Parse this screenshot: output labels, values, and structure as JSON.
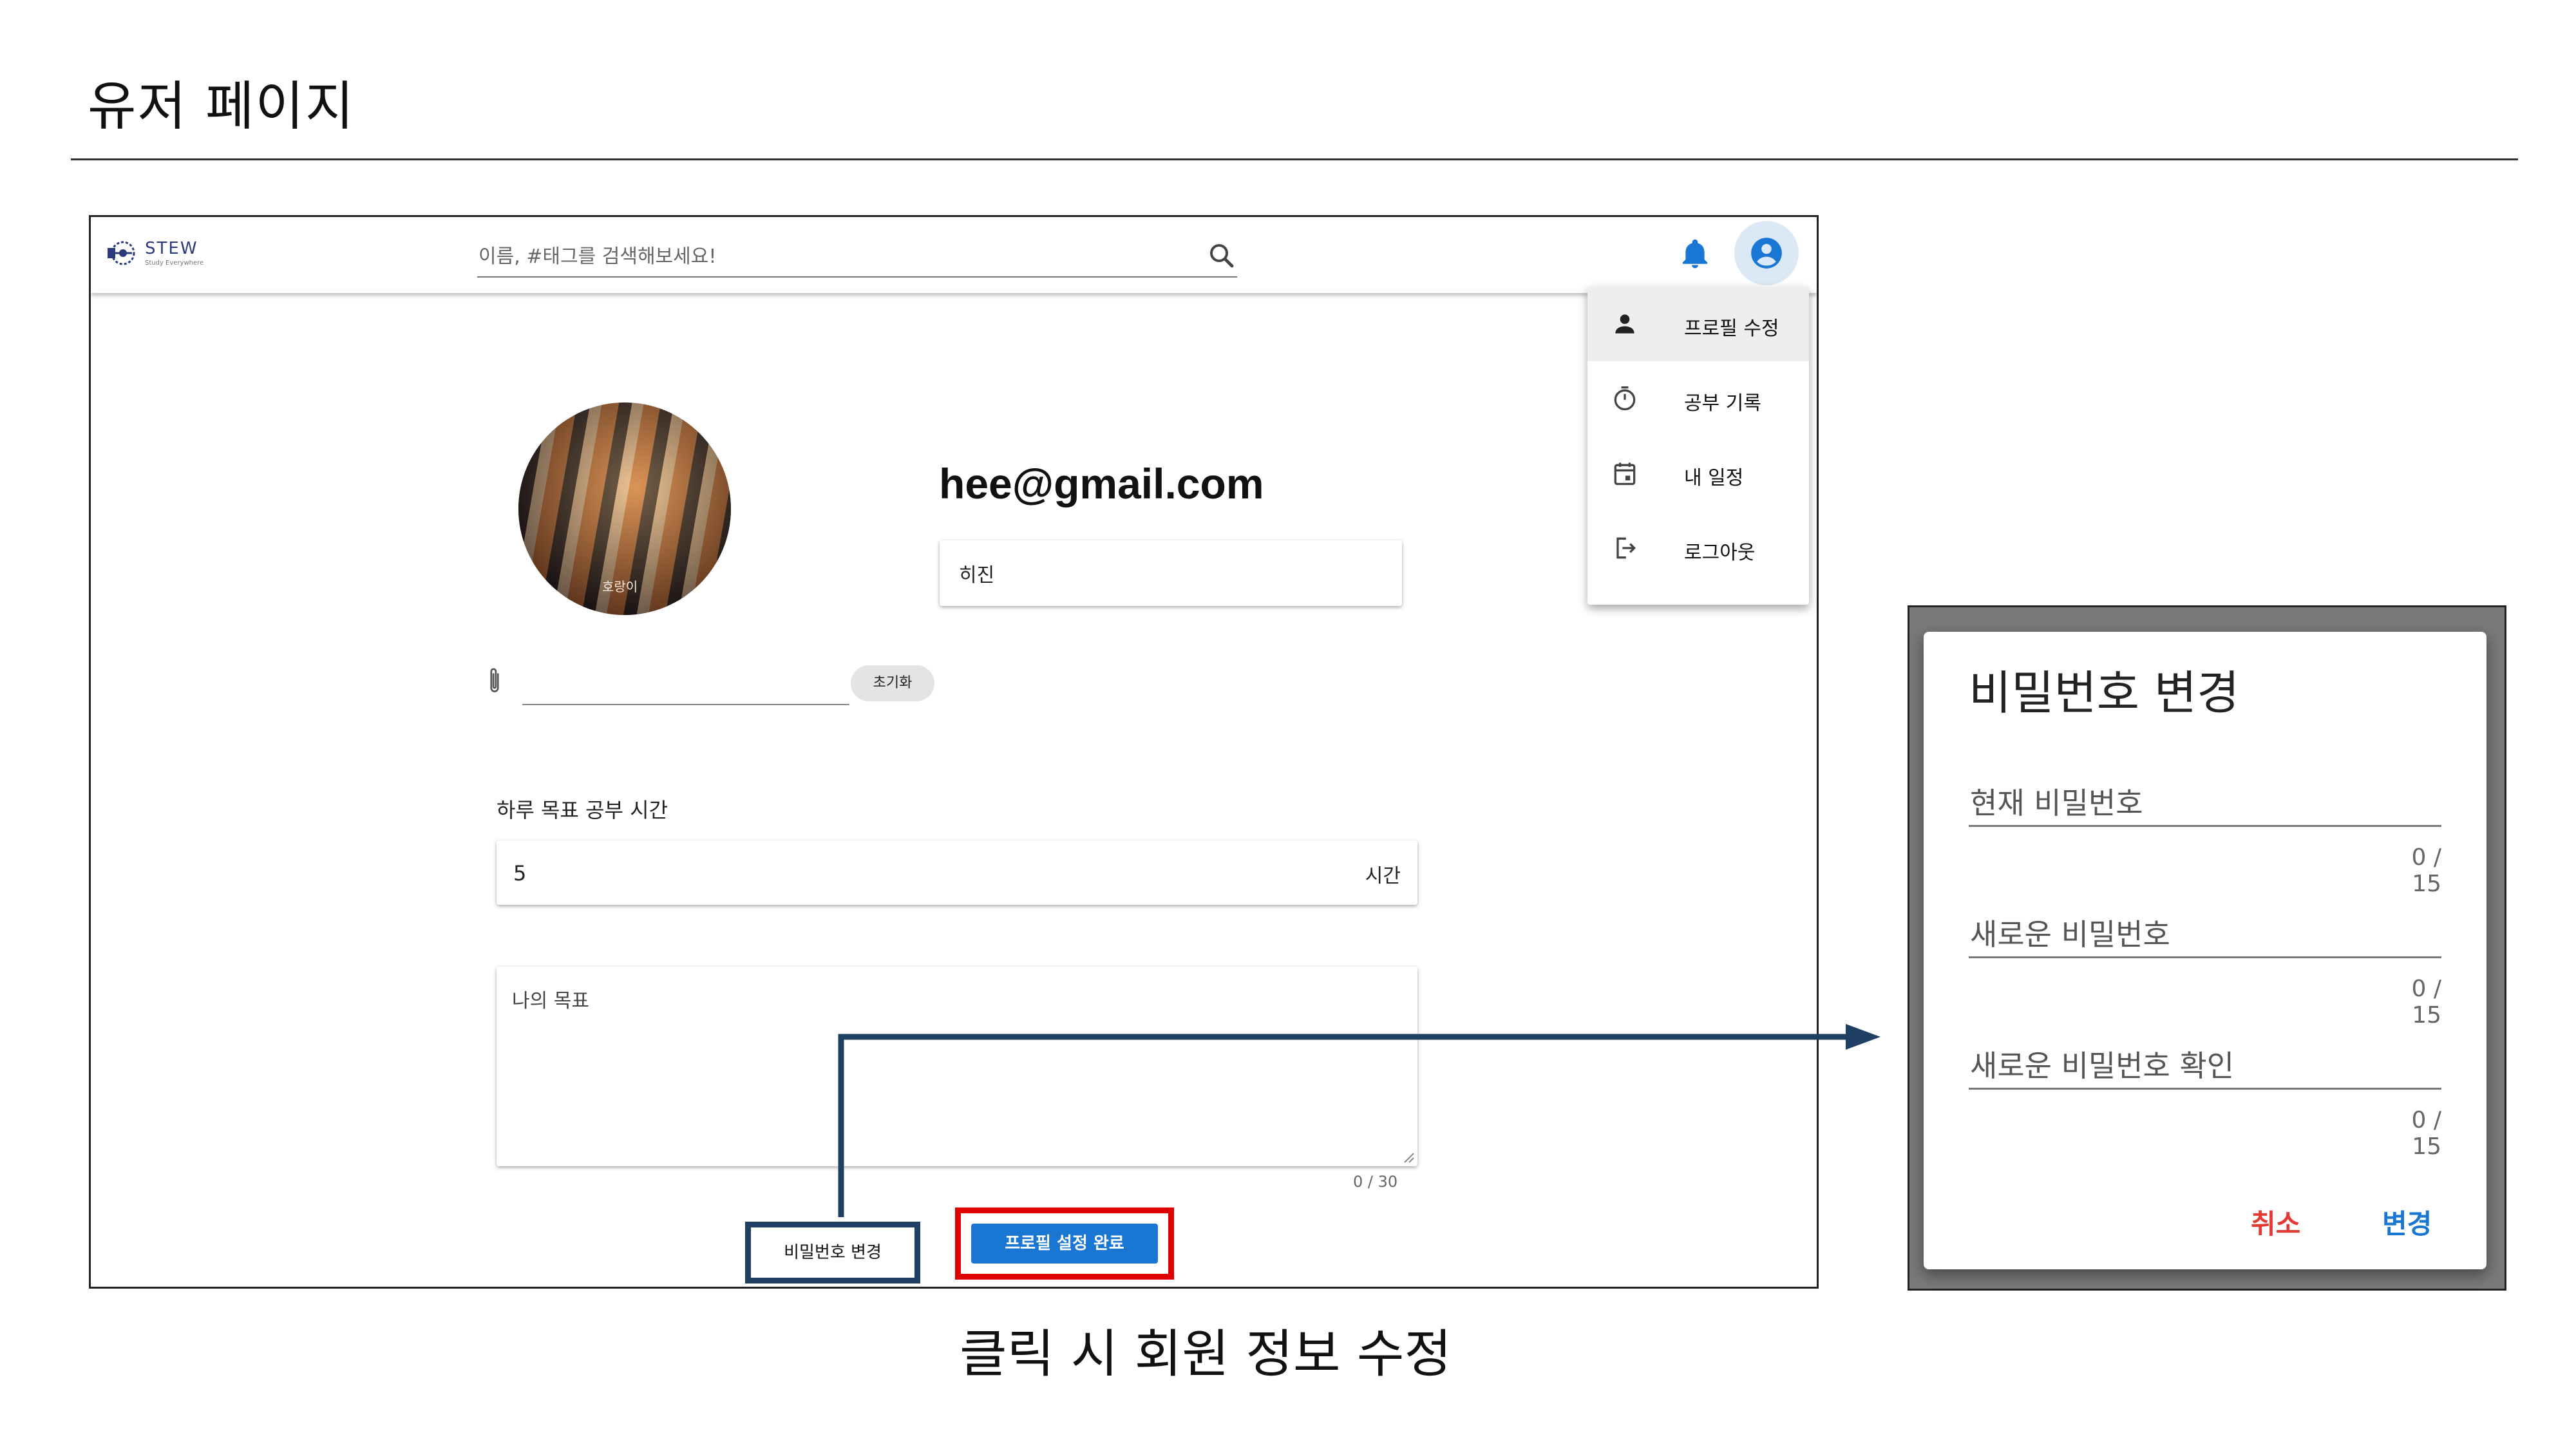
{
  "slide": {
    "title": "유저 페이지",
    "caption": "클릭 시 회원 정보 수정"
  },
  "app": {
    "logo": {
      "name": "STEW",
      "tagline": "Study Everywhere"
    },
    "search": {
      "placeholder": "이름, #태그를 검색해보세요!",
      "value": ""
    },
    "icons": {
      "search": "search-icon",
      "notifications": "bell-icon",
      "account": "account-circle-icon"
    },
    "colors": {
      "primary": "#1976d2",
      "highlight_red": "#e00000",
      "highlight_navy": "#1f3f64"
    },
    "menu": {
      "items": [
        {
          "label": "프로필 수정",
          "icon": "person-icon"
        },
        {
          "label": "공부 기록",
          "icon": "timer-icon"
        },
        {
          "label": "내 일정",
          "icon": "calendar-icon"
        },
        {
          "label": "로그아웃",
          "icon": "logout-icon"
        }
      ]
    },
    "profile": {
      "avatar_caption": "호랑이",
      "email": "hee@gmail.com",
      "nickname": "히진",
      "reset_label": "초기화",
      "daily_goal_label": "하루 목표 공부 시간",
      "daily_goal_value": "5",
      "daily_goal_suffix": "시간",
      "my_goal_placeholder": "나의 목표",
      "my_goal_counter": "0 / 30",
      "password_button": "비밀번호 변경",
      "complete_button": "프로필 설정 완료"
    }
  },
  "dialog": {
    "title": "비밀번호 변경",
    "fields": [
      {
        "placeholder": "현재 비밀번호",
        "counter": "0 / 15"
      },
      {
        "placeholder": "새로운 비밀번호",
        "counter": "0 / 15"
      },
      {
        "placeholder": "새로운 비밀번호 확인",
        "counter": "0 / 15"
      }
    ],
    "cancel_label": "취소",
    "confirm_label": "변경"
  }
}
